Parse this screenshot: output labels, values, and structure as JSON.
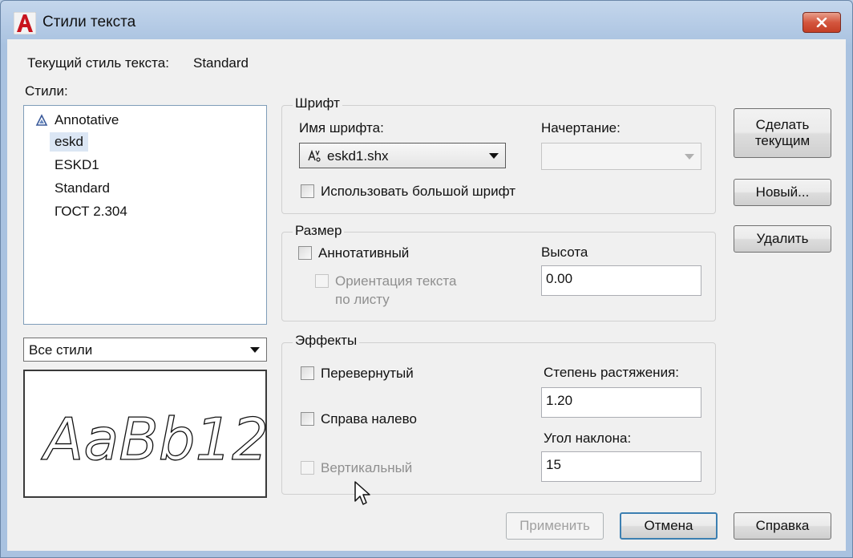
{
  "window": {
    "title": "Стили текста"
  },
  "current_style": {
    "label": "Текущий стиль текста:",
    "value": "Standard"
  },
  "styles": {
    "label": "Стили:",
    "items": [
      {
        "label": "Annotative",
        "icon": "annotative-triangle-icon"
      },
      {
        "label": "eskd",
        "selected": true
      },
      {
        "label": "ESKD1"
      },
      {
        "label": "Standard"
      },
      {
        "label": "ГОСТ 2.304"
      }
    ],
    "filter_value": "Все стили"
  },
  "preview": {
    "text": "AaBb12"
  },
  "font": {
    "group_title": "Шрифт",
    "name_label": "Имя шрифта:",
    "name_value": "eskd1.shx",
    "name_icon": "shx-font-icon",
    "style_label": "Начертание:",
    "style_value": "",
    "big_font_label": "Использовать большой шрифт"
  },
  "size": {
    "group_title": "Размер",
    "annotative_label": "Аннотативный",
    "orientation_label_line1": "Ориентация текста",
    "orientation_label_line2": "по листу",
    "height_label": "Высота",
    "height_value": "0.00"
  },
  "effects": {
    "group_title": "Эффекты",
    "upside_down_label": "Перевернутый",
    "backwards_label": "Справа налево",
    "vertical_label": "Вертикальный",
    "width_factor_label": "Степень растяжения:",
    "width_factor_value": "1.20",
    "oblique_label": "Угол наклона:",
    "oblique_value": "15"
  },
  "buttons": {
    "set_current_line1": "Сделать",
    "set_current_line2": "текущим",
    "new": "Новый...",
    "delete": "Удалить",
    "apply": "Применить",
    "cancel": "Отмена",
    "help": "Справка"
  },
  "colors": {
    "titlebar": "#a9c2e0",
    "close_button": "#c43e25",
    "dialog_background": "#f0f0f0",
    "default_button_border": "#3c7fb1"
  }
}
